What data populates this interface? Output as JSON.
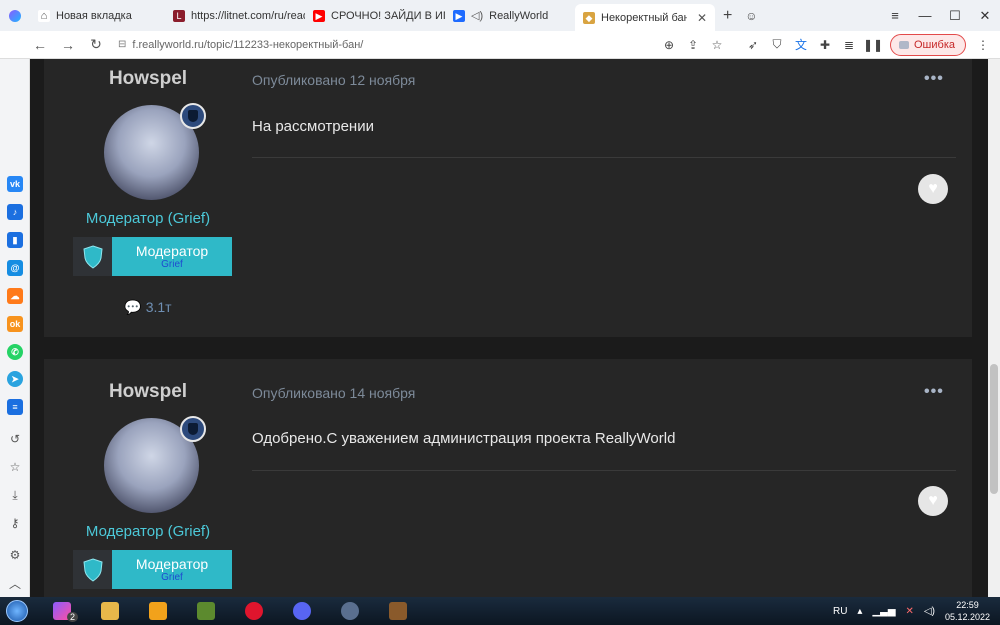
{
  "browser": {
    "tabs": [
      {
        "title": "Новая вкладка",
        "fav_color": "#888888",
        "fav_glyph": "⌂"
      },
      {
        "title": "https://litnet.com/ru/reader/y",
        "fav_color": "#8b1d2c",
        "fav_glyph": "L"
      },
      {
        "title": "СРОЧНО! ЗАЙДИ В ИГРУ! Я",
        "fav_color": "#ff0000",
        "fav_glyph": "▶"
      },
      {
        "title": "ReallyWorld",
        "fav_color": "#1e6bff",
        "fav_glyph": "▶"
      },
      {
        "title": "Некоректный бан - Жалобы",
        "fav_color": "#d9a441",
        "fav_glyph": "◆"
      }
    ],
    "url": "f.reallyworld.ru/topic/112233-некоректный-бан/",
    "error_label": "Ошибка"
  },
  "posts": [
    {
      "author": "Howspel",
      "role": "Модератор (Grief)",
      "group_title": "Модератор",
      "group_sub": "Grief",
      "post_count": "3.1т",
      "date": "Опубликовано 12 ноября",
      "body": "На рассмотрении"
    },
    {
      "author": "Howspel",
      "role": "Модератор (Grief)",
      "group_title": "Модератор",
      "group_sub": "Grief",
      "date": "Опубликовано 14 ноября",
      "body": "Одобрено.С уважением администрация проекта ReallyWorld"
    }
  ],
  "sidebar_icons": [
    {
      "name": "vk-icon",
      "color": "#2787f5",
      "glyph": "vk"
    },
    {
      "name": "music-icon",
      "color": "#1b6fe0",
      "glyph": "♪"
    },
    {
      "name": "stats-icon",
      "color": "#1b6fe0",
      "glyph": "▮"
    },
    {
      "name": "mail-icon",
      "color": "#168de2",
      "glyph": "@"
    },
    {
      "name": "cloud-icon",
      "color": "#ff7a1a",
      "glyph": "☁"
    },
    {
      "name": "odnoklassniki-icon",
      "color": "#f7931e",
      "glyph": "ok"
    },
    {
      "name": "whatsapp-icon",
      "color": "#25d366",
      "glyph": "✆"
    },
    {
      "name": "telegram-icon",
      "color": "#2aa3df",
      "glyph": "➤"
    },
    {
      "name": "list-icon",
      "color": "#1b6fe0",
      "glyph": "≡"
    }
  ],
  "taskbar": {
    "badge_count": "2",
    "lang": "RU",
    "time": "22:59",
    "date": "05.12.2022"
  }
}
